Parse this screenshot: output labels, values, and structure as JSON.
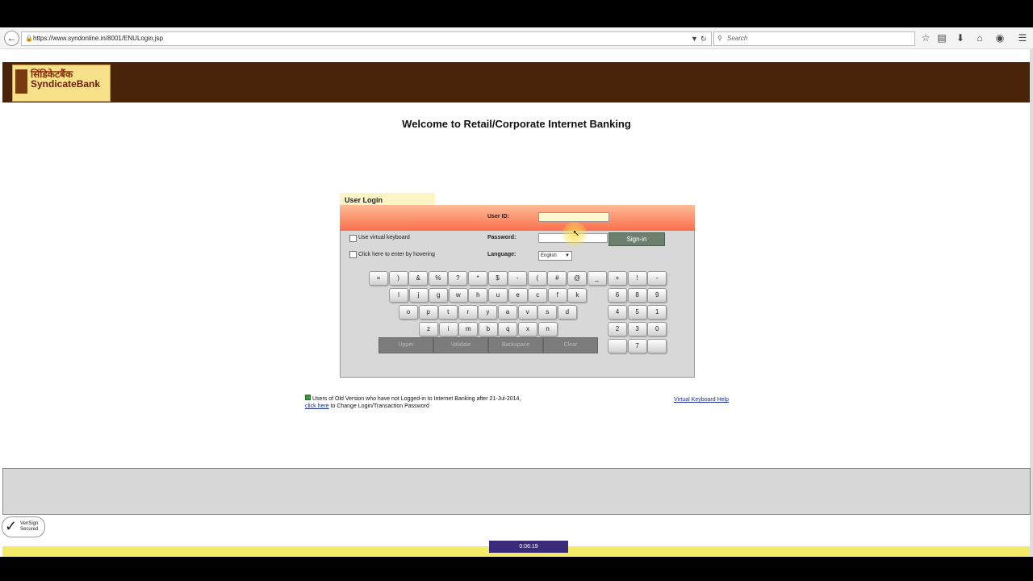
{
  "browser": {
    "url": "https://www.syndonline.in/8001/ENULogin.jsp",
    "search_placeholder": "Search"
  },
  "banner": {
    "logo_hindi": "सिंडिकेटबैंक",
    "logo_brand": "SyndicateBank"
  },
  "page": {
    "welcome_title": "Welcome to Retail/Corporate Internet Banking"
  },
  "login": {
    "tab_label": "User Login",
    "user_id_label": "User ID:",
    "password_label": "Password:",
    "virtual_keyboard_label": "Use virtual keyboard",
    "hover_label": "Click here to enter by hovering",
    "language_label": "Language:",
    "language_value": "English",
    "signin_label": "Sign-in"
  },
  "keyboard": {
    "row1": [
      "=",
      ")",
      "&",
      "%",
      "?",
      "*",
      "$",
      "-",
      "(",
      "#",
      "@",
      "_"
    ],
    "row2": [
      "l",
      "j",
      "g",
      "w",
      "h",
      "u",
      "e",
      "c",
      "f",
      "k"
    ],
    "row3": [
      "o",
      "p",
      "t",
      "r",
      "y",
      "a",
      "v",
      "s",
      "d"
    ],
    "row4": [
      "z",
      "i",
      "m",
      "b",
      "q",
      "x",
      "n"
    ],
    "numrow1": [
      "+",
      "!",
      "-"
    ],
    "numrow2": [
      "6",
      "8",
      "9"
    ],
    "numrow3": [
      "4",
      "5",
      "1"
    ],
    "numrow4": [
      "2",
      "3",
      "0"
    ],
    "numrow5": [
      "",
      "7",
      ""
    ],
    "function_keys": [
      "Upper",
      "Validate",
      "Backspace",
      "Clear"
    ]
  },
  "notice": {
    "text": "Users of Old Version who have not Logged-in to Internet Banking after 21-Jul-2014,",
    "link": "click here",
    "suffix": "to Change Login/Transaction Password"
  },
  "help": {
    "virtual_keyboard_help": "Virtual Keyboard Help"
  },
  "verisign": {
    "line1": "VeriSign",
    "line2": "Secured"
  },
  "recorder": {
    "time": "0:06:19"
  }
}
